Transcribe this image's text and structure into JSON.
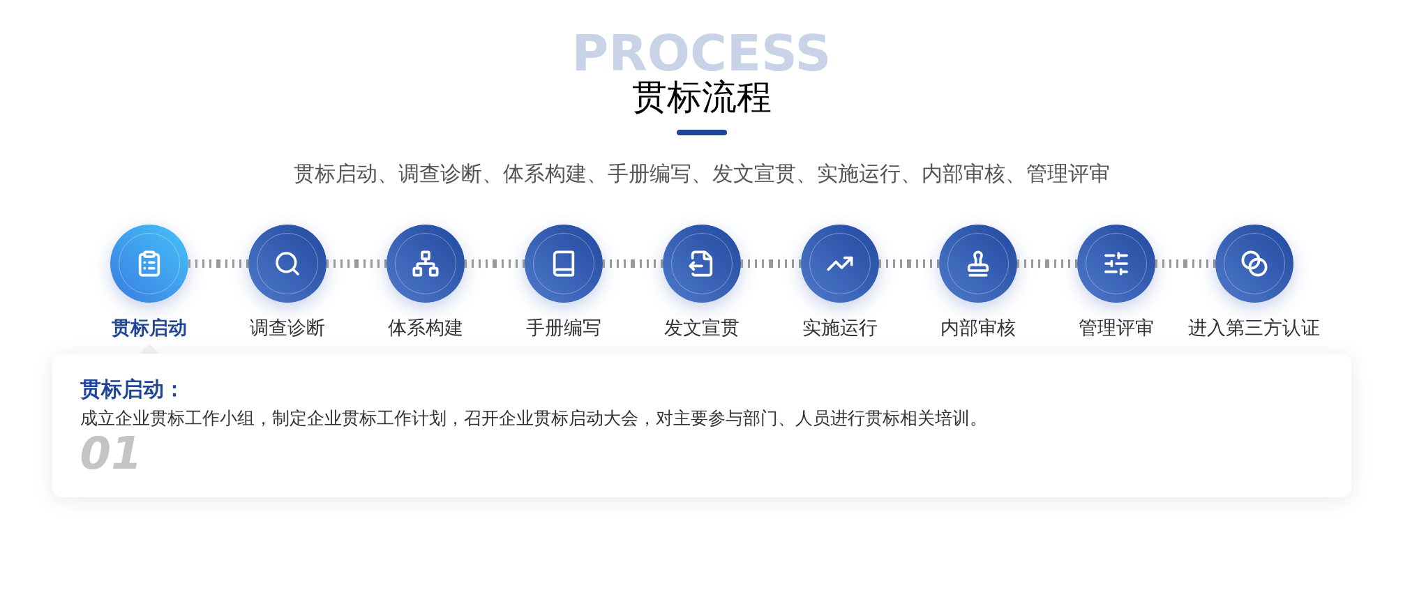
{
  "header": {
    "watermark": "PROCESS",
    "title": "贯标流程",
    "subtitle": "贯标启动、调查诊断、体系构建、手册编写、发文宣贯、实施运行、内部审核、管理评审"
  },
  "steps": [
    {
      "label": "贯标启动",
      "selected": true,
      "kind": "clipboard"
    },
    {
      "label": "调查诊断",
      "selected": false,
      "kind": "search"
    },
    {
      "label": "体系构建",
      "selected": false,
      "kind": "hierarchy"
    },
    {
      "label": "手册编写",
      "selected": false,
      "kind": "book"
    },
    {
      "label": "发文宣贯",
      "selected": false,
      "kind": "document"
    },
    {
      "label": "实施运行",
      "selected": false,
      "kind": "trend"
    },
    {
      "label": "内部审核",
      "selected": false,
      "kind": "stamp"
    },
    {
      "label": "管理评审",
      "selected": false,
      "kind": "sliders"
    },
    {
      "label": "进入第三方认证",
      "selected": false,
      "kind": "circles"
    }
  ],
  "detail": {
    "number": "01",
    "title": "贯标启动：",
    "text": "成立企业贯标工作小组，制定企业贯标工作计划，召开企业贯标启动大会，对主要参与部门、人员进行贯标相关培训。"
  }
}
